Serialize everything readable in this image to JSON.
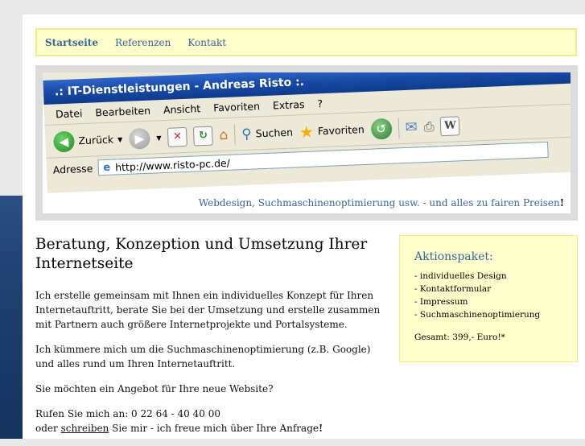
{
  "nav": {
    "items": [
      {
        "label": "Startseite",
        "active": true
      },
      {
        "label": "Referenzen",
        "active": false
      },
      {
        "label": "Kontakt",
        "active": false
      }
    ]
  },
  "banner": {
    "browser_title": ".: IT-Dienstleistungen - Andreas Risto :.",
    "menu": [
      "Datei",
      "Bearbeiten",
      "Ansicht",
      "Favoriten",
      "Extras",
      "?"
    ],
    "toolbar": {
      "back_label": "Zurück",
      "search_label": "Suchen",
      "favorites_label": "Favoriten"
    },
    "address_label": "Adresse",
    "address_url": "http://www.risto-pc.de/",
    "tagline": "Webdesign, Suchmaschinenoptimierung usw. - und alles zu fairen Preisen",
    "tagline_end": "!"
  },
  "main": {
    "heading": "Beratung, Konzeption und Umsetzung Ihrer Internetseite",
    "para1": "Ich erstelle gemeinsam mit Ihnen ein individuelles Konzept für Ihren Internetauftritt, berate Sie bei der Umsetzung und erstelle zusammen mit Partnern auch größere Internetprojekte und Portalsysteme.",
    "para2": "Ich kümmere mich um die Suchmaschinenoptimierung (z.B. Google) und alles rund um Ihren Internetauftritt.",
    "para3": "Sie möchten ein Angebot für Ihre neue Website?",
    "phone_line": "Rufen Sie mich an: 0 22 64 - 40 40 00",
    "contact_prefix": "oder ",
    "contact_link": "schreiben",
    "contact_suffix": " Sie mir - ich freue mich über Ihre Anfrage",
    "contact_end": "!"
  },
  "sidebar": {
    "title": "Aktionspaket:",
    "items": [
      "- individuelles Design",
      "- Kontaktformular",
      "- Impressum",
      "- Suchmaschinenoptimierung"
    ],
    "total": "Gesamt: 399,- Euro!*"
  },
  "colors": {
    "link": "#36669b",
    "nav_bg": "#ffffcc",
    "nav_border": "#f3ea8c",
    "banner_frame": "#dcdcdc"
  }
}
